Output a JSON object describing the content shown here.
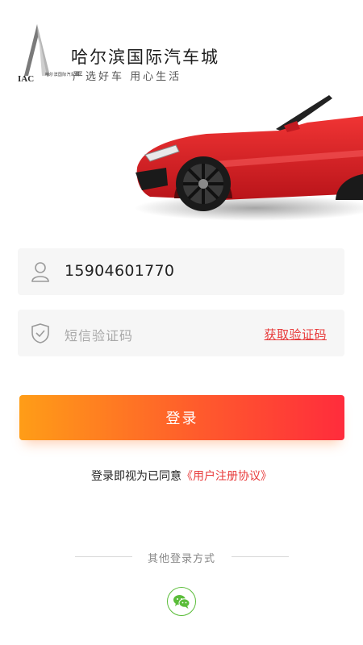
{
  "brand": {
    "title": "哈尔滨国际汽车城",
    "slogan": "严选好车 用心生活",
    "logo_caption": "哈尔滨国际汽车城",
    "logo_text": "IAC"
  },
  "login_form": {
    "phone_value": "15904601770",
    "sms_placeholder": "短信验证码",
    "get_code_label": "获取验证码",
    "login_label": "登录"
  },
  "agreement": {
    "prefix": "登录即视为已同意",
    "link": "《用户注册协议》"
  },
  "other_login": {
    "label": "其他登录方式"
  },
  "colors": {
    "accent_red": "#e83b3b",
    "button_gradient_start": "#ff9d17",
    "button_gradient_end": "#ff2c3c",
    "wechat_green": "#5bbd3a"
  },
  "icons": [
    "iac-logo",
    "car-image",
    "user-icon",
    "shield-icon",
    "wechat-icon"
  ]
}
